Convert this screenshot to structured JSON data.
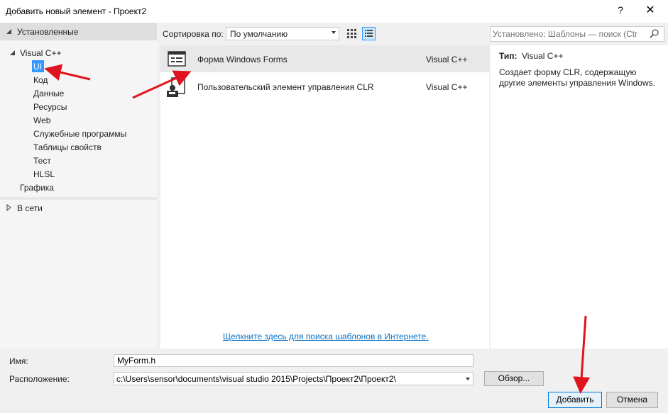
{
  "window": {
    "title": "Добавить новый элемент - Проект2",
    "help_label": "?",
    "close_label": "✕"
  },
  "left_panel": {
    "installed_label": "Установленные",
    "tree": {
      "root": "Visual C++",
      "children": [
        "UI",
        "Код",
        "Данные",
        "Ресурсы",
        "Web",
        "Служебные программы",
        "Таблицы свойств",
        "Тест",
        "HLSL"
      ],
      "graphics": "Графика"
    },
    "online_label": "В сети",
    "selected": "UI"
  },
  "toolbar": {
    "sort_label": "Сортировка по:",
    "sort_value": "По умолчанию",
    "search_placeholder": "Установлено: Шаблоны — поиск (Ctr"
  },
  "templates": [
    {
      "name": "Форма Windows Forms",
      "lang": "Visual C++",
      "icon": "form-icon",
      "selected": true
    },
    {
      "name": "Пользовательский элемент управления CLR",
      "lang": "Visual C++",
      "icon": "user-control-icon",
      "selected": false
    }
  ],
  "online_link": "Щелкните здесь для поиска шаблонов в Интернете.",
  "details": {
    "type_label": "Тип:",
    "type_value": "Visual C++",
    "description": "Создает форму CLR, содержащую другие элементы управления Windows."
  },
  "form": {
    "name_label": "Имя:",
    "name_value": "MyForm.h",
    "location_label": "Расположение:",
    "location_value": "c:\\Users\\sensor\\documents\\visual studio 2015\\Projects\\Проект2\\Проект2\\",
    "browse_label": "Обзор...",
    "add_label": "Добавить",
    "cancel_label": "Отмена"
  },
  "colors": {
    "selection": "#3399ff",
    "link": "#0e70c0",
    "annotation_arrow": "#e0141e"
  }
}
